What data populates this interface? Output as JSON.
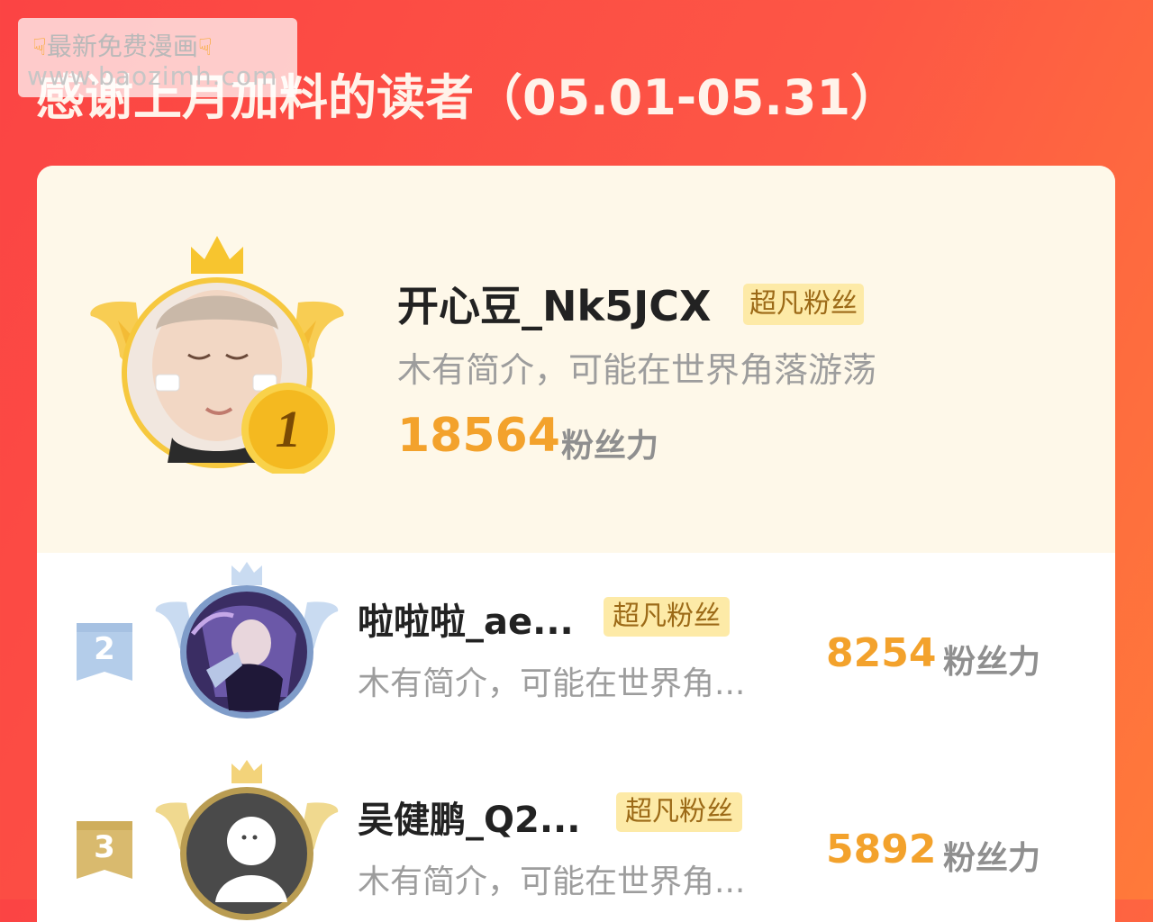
{
  "watermark": {
    "hand_icon": "pointing-down-hand-icon",
    "line1": "最新免费漫画",
    "line2": "www.baozimh.com"
  },
  "header": {
    "title": "感谢上月加料的读者（05.01-05.31）"
  },
  "colors": {
    "background": "#fb4444",
    "accent_score": "#f3a22c",
    "tag_bg": "#fdeaa7",
    "gold": "#f5c23a",
    "silver": "#a9c4e4",
    "bronze": "#d7b465"
  },
  "leaderboard": {
    "first": {
      "rank": "1",
      "name": "开心豆_Nk5JCX",
      "tag": "超凡粉丝",
      "bio": "木有简介，可能在世界角落游荡",
      "score": "18564",
      "score_unit": "粉丝力"
    },
    "rows": [
      {
        "rank": "2",
        "name": "啦啦啦_ae...",
        "tag": "超凡粉丝",
        "bio": "木有简介，可能在世界角...",
        "score": "8254",
        "score_unit": "粉丝力"
      },
      {
        "rank": "3",
        "name": "吴健鹏_Q2...",
        "tag": "超凡粉丝",
        "bio": "木有简介，可能在世界角...",
        "score": "5892",
        "score_unit": "粉丝力"
      }
    ]
  }
}
